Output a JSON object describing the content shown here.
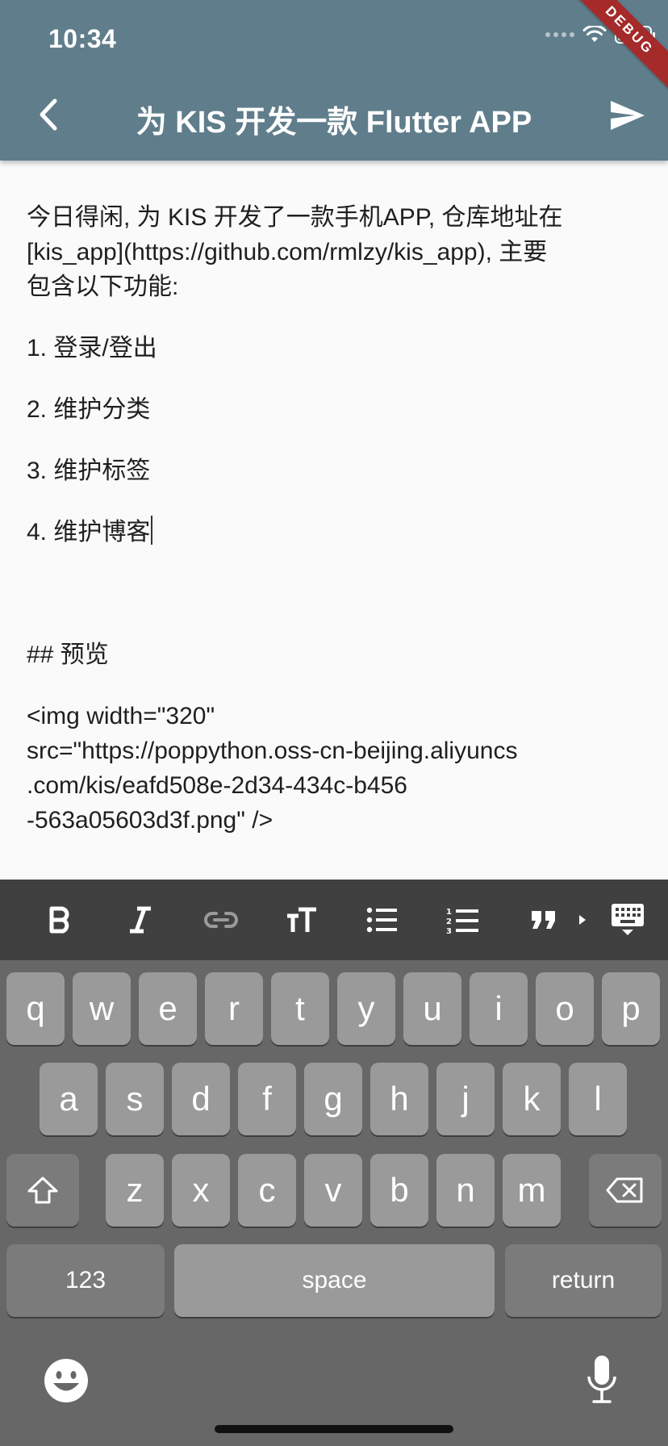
{
  "status_bar": {
    "time": "10:34",
    "debug_label": "DEBUG"
  },
  "app_bar": {
    "title": "为 KIS 开发一款 Flutter APP"
  },
  "editor": {
    "lines": [
      "今日得闲, 为 KIS 开发了一款手机APP, 仓库地址在",
      "[kis_app](https://github.com/rmlzy/kis_app), 主要",
      "包含以下功能:",
      "1. 登录/登出",
      "2. 维护分类",
      "3. 维护标签",
      "4. 维护博客",
      "## 预览",
      "<img width=\"320\"",
      "src=\"https://poppython.oss-cn-beijing.aliyuncs",
      ".com/kis/eafd508e-2d34-434c-b456",
      "-563a05603d3f.png\" />"
    ]
  },
  "toolbar": {
    "items": [
      {
        "name": "bold",
        "icon": "bold-icon"
      },
      {
        "name": "italic",
        "icon": "italic-icon"
      },
      {
        "name": "link",
        "icon": "link-icon"
      },
      {
        "name": "text-size",
        "icon": "text-size-icon"
      },
      {
        "name": "bullet-list",
        "icon": "bullet-list-icon"
      },
      {
        "name": "numbered-list",
        "icon": "numbered-list-icon"
      },
      {
        "name": "quote",
        "icon": "quote-icon"
      },
      {
        "name": "more",
        "icon": "triangle-right-icon"
      },
      {
        "name": "hide-keyboard",
        "icon": "keyboard-hide-icon"
      }
    ]
  },
  "keyboard": {
    "row1": [
      "q",
      "w",
      "e",
      "r",
      "t",
      "y",
      "u",
      "i",
      "o",
      "p"
    ],
    "row2": [
      "a",
      "s",
      "d",
      "f",
      "g",
      "h",
      "j",
      "k",
      "l"
    ],
    "row3": [
      "z",
      "x",
      "c",
      "v",
      "b",
      "n",
      "m"
    ],
    "numbers_label": "123",
    "space_label": "space",
    "return_label": "return"
  },
  "colors": {
    "app_bar": "#607d8b",
    "toolbar": "#404040",
    "keyboard": "#676767",
    "debug_ribbon": "#a52a2a"
  }
}
